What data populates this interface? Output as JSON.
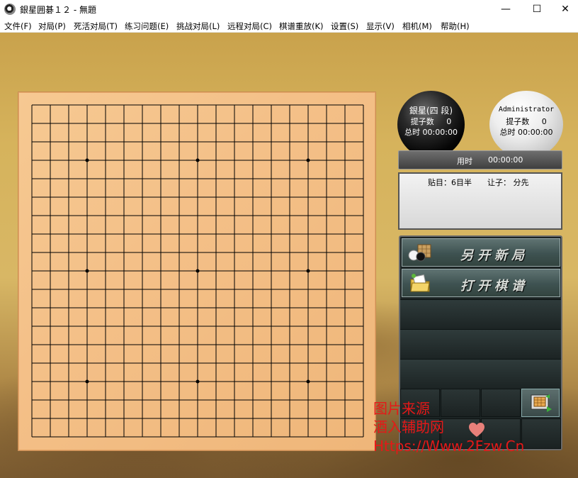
{
  "window": {
    "title": "銀星囲碁１２ - 無題",
    "minimize_glyph": "—",
    "maximize_glyph": "☐",
    "close_glyph": "✕"
  },
  "menu": {
    "items": [
      {
        "label": "文件(F)"
      },
      {
        "label": "对局(P)"
      },
      {
        "label": "死活对局(T)"
      },
      {
        "label": "练习问题(E)"
      },
      {
        "label": "挑战对局(L)"
      },
      {
        "label": "远程对局(C)"
      },
      {
        "label": "棋谱重放(K)"
      },
      {
        "label": "设置(S)"
      },
      {
        "label": "显示(V)"
      },
      {
        "label": "相机(M)"
      },
      {
        "label": "帮助(H)"
      }
    ]
  },
  "board": {
    "size": 19,
    "star_points": [
      [
        3,
        3
      ],
      [
        3,
        9
      ],
      [
        3,
        15
      ],
      [
        9,
        3
      ],
      [
        9,
        9
      ],
      [
        9,
        15
      ],
      [
        15,
        3
      ],
      [
        15,
        9
      ],
      [
        15,
        15
      ]
    ]
  },
  "players": {
    "black": {
      "name": "銀星(四 段)",
      "captures_label": "提子数",
      "captures": "0",
      "total_time_label": "总时",
      "total_time": "00:00:00"
    },
    "white": {
      "name": "Administrator",
      "captures_label": "提子数",
      "captures": "0",
      "total_time_label": "总时",
      "total_time": "00:00:00"
    }
  },
  "timer": {
    "label": "用时",
    "value": "00:00:00"
  },
  "info": {
    "komi": "贴目：6目半",
    "handicap": "让子：  分先"
  },
  "buttons": {
    "new_game": "另开新局",
    "open_record": "打开棋谱"
  },
  "watermark": {
    "line1": "图片来源",
    "line2": "酒入辅助网",
    "line3": "Https://Www.2Fzw.Cn"
  },
  "colors": {
    "board": "#f4c088",
    "grid": "#000000",
    "panel": "#1c2424",
    "watermark": "#e51818"
  }
}
